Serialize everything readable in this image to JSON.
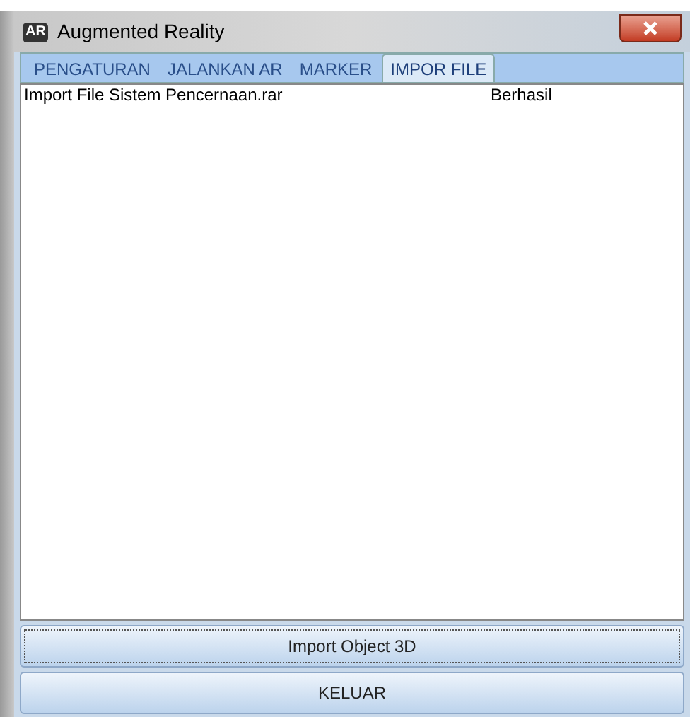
{
  "window": {
    "logo": "AR",
    "title": "Augmented Reality"
  },
  "tabs": [
    {
      "label": "PENGATURAN",
      "selected": false
    },
    {
      "label": "JALANKAN AR",
      "selected": false
    },
    {
      "label": "MARKER",
      "selected": false
    },
    {
      "label": "IMPOR FILE",
      "selected": true
    }
  ],
  "list": [
    {
      "name": "Import File Sistem Pencernaan.rar",
      "status": "Berhasil"
    }
  ],
  "buttons": [
    {
      "label": "Import Object 3D",
      "focused": true
    },
    {
      "label": "KELUAR",
      "focused": false
    }
  ]
}
